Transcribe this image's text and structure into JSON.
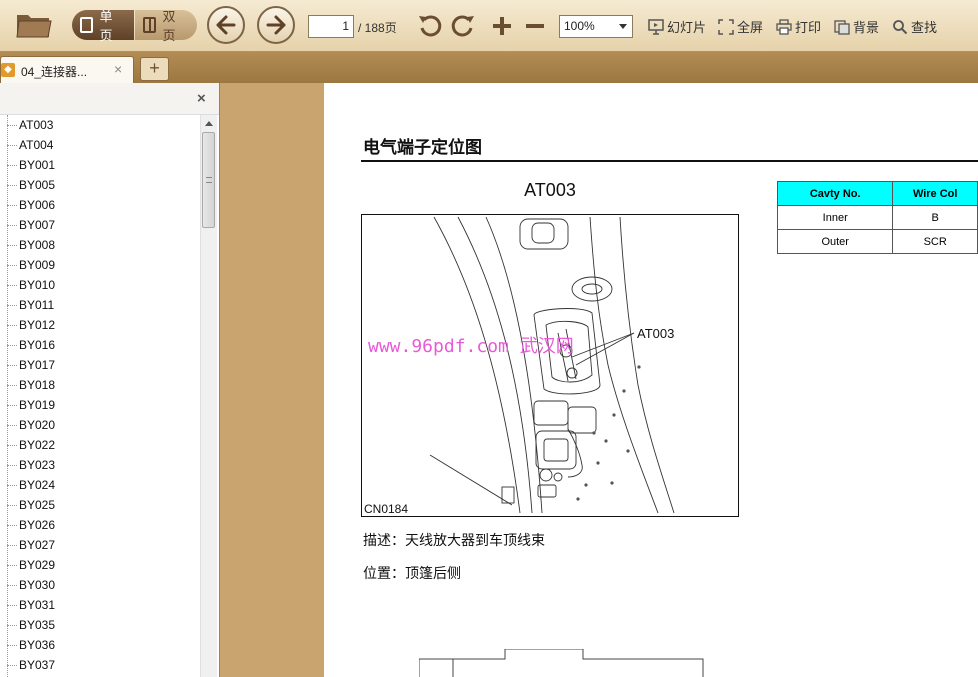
{
  "toolbar": {
    "single_page_label": "单页",
    "double_page_label": "双页",
    "current_page": "1",
    "total_pages": "/ 188页",
    "zoom": "100%",
    "actions": {
      "slideshow": "幻灯片",
      "fullscreen": "全屏",
      "print": "打印",
      "background": "背景",
      "search": "查找"
    }
  },
  "tabs": [
    {
      "label": "04_连接器...",
      "close": "×"
    }
  ],
  "add_tab": "+",
  "sidebar": {
    "close": "×",
    "items": [
      "AT003",
      "AT004",
      "BY001",
      "BY005",
      "BY006",
      "BY007",
      "BY008",
      "BY009",
      "BY010",
      "BY011",
      "BY012",
      "BY016",
      "BY017",
      "BY018",
      "BY019",
      "BY020",
      "BY022",
      "BY023",
      "BY024",
      "BY025",
      "BY026",
      "BY027",
      "BY029",
      "BY030",
      "BY031",
      "BY035",
      "BY036",
      "BY037"
    ]
  },
  "document": {
    "title": "电气端子定位图",
    "figure_title": "AT003",
    "figure_code": "CN0184",
    "callout_label": "AT003",
    "watermark": "www.96pdf.com 武汉网",
    "description": "描述：天线放大器到车顶线束",
    "location": "位置：顶篷后侧",
    "table": {
      "headers": [
        "Cavty No.",
        "Wire Col"
      ],
      "rows": [
        [
          "Inner",
          "B"
        ],
        [
          "Outer",
          "SCR"
        ]
      ]
    }
  },
  "colors": {
    "toolbar_bg": "#f0e3c6",
    "workspace_bg": "#c9a46e",
    "table_header": "#00ffff",
    "watermark": "#e85ad8"
  }
}
